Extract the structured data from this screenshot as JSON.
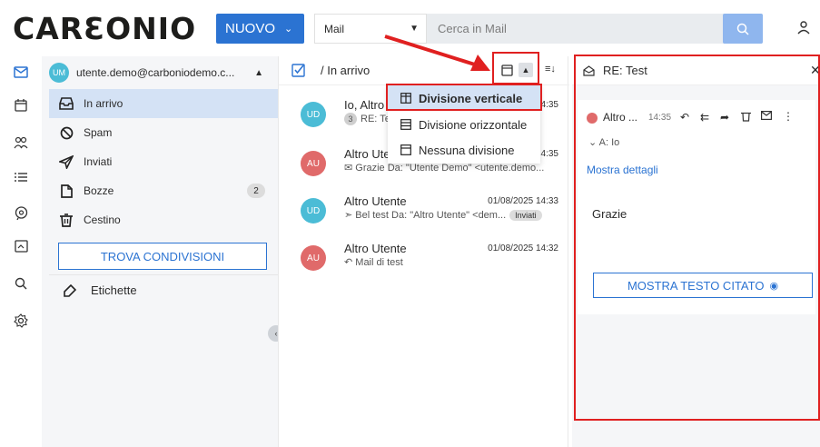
{
  "header": {
    "logo": "CARƐONIO",
    "new_button": "NUOVO",
    "module": "Mail",
    "search_placeholder": "Cerca in Mail"
  },
  "sidebar": {
    "account_initials": "UM",
    "account_email": "utente.demo@carboniodemo.c...",
    "folders": [
      {
        "label": "In arrivo",
        "icon": "inbox-icon"
      },
      {
        "label": "Spam",
        "icon": "block-icon"
      },
      {
        "label": "Inviati",
        "icon": "send-icon"
      },
      {
        "label": "Bozze",
        "icon": "draft-icon",
        "badge": "2"
      },
      {
        "label": "Cestino",
        "icon": "trash-icon"
      }
    ],
    "find_shares": "TROVA CONDIVISIONI",
    "tags": "Etichette"
  },
  "list": {
    "breadcrumb": "/ In arrivo",
    "rows": [
      {
        "initials": "UD",
        "sender": "Io, Altro Ute",
        "count": "3",
        "subject": "RE: Test",
        "time": "4:35",
        "color": "#4bbcd6"
      },
      {
        "initials": "AU",
        "sender": "Altro Ute",
        "preview": "Grazie Da: \"Utente Demo\" <utente.demo...",
        "time": "4:35",
        "color": "#e06a6a"
      },
      {
        "initials": "UD",
        "sender": "Altro Utente",
        "preview": "Bel test Da: \"Altro Utente\" <dem...",
        "tag": "Inviati",
        "time": "01/08/2025 14:33",
        "color": "#4bbcd6"
      },
      {
        "initials": "AU",
        "sender": "Altro Utente",
        "preview": "Mail di test",
        "time": "01/08/2025 14:32",
        "color": "#e06a6a"
      }
    ]
  },
  "menu": {
    "items": [
      {
        "label": "Divisione verticale",
        "selected": true
      },
      {
        "label": "Divisione orizzontale",
        "selected": false
      },
      {
        "label": "Nessuna divisione",
        "selected": false
      }
    ]
  },
  "reader": {
    "subject": "RE: Test",
    "from": "Altro ...",
    "time": "14:35",
    "to_label": "A: Io",
    "details": "Mostra dettagli",
    "body": "Grazie",
    "show_quoted": "MOSTRA TESTO CITATO"
  },
  "colors": {
    "accent": "#2b73d2",
    "annotation": "#e02020"
  }
}
